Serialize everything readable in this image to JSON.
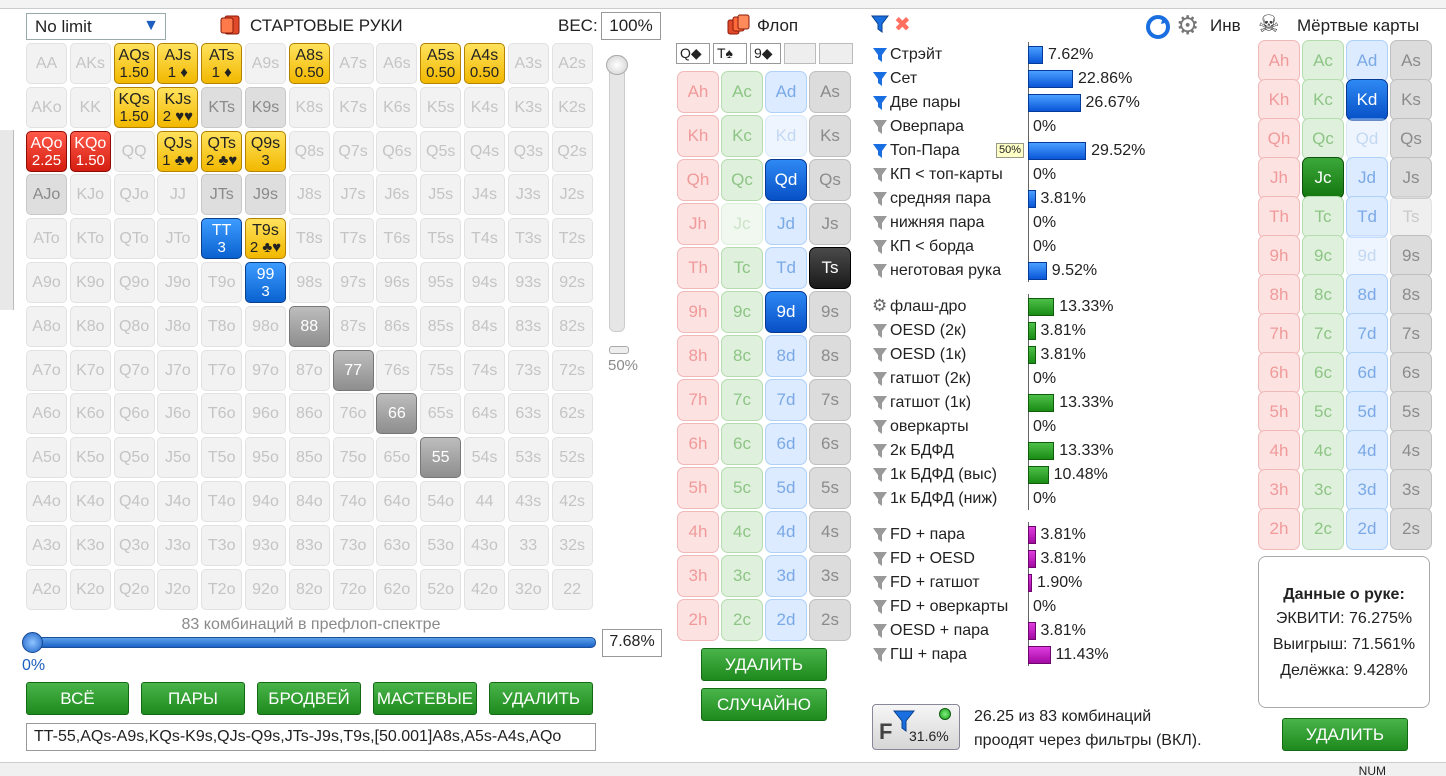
{
  "toolbar": {
    "game_select": "No limit",
    "start_hands_label": "СТАРТОВЫЕ РУКИ",
    "weight_label": "ВЕС:",
    "weight_value": "100%",
    "flop_label": "Флоп",
    "inv_label": "Инв",
    "dead_cards_label": "Мёртвые карты"
  },
  "preflop": {
    "ranks": [
      "A",
      "K",
      "Q",
      "J",
      "T",
      "9",
      "8",
      "7",
      "6",
      "5",
      "4",
      "3",
      "2"
    ],
    "special": {
      "AQs": {
        "style": "y",
        "w": "1.50"
      },
      "AJs": {
        "style": "y",
        "w": "1",
        "suit": "♦"
      },
      "ATs": {
        "style": "y",
        "w": "1",
        "suit": "♦"
      },
      "A8s": {
        "style": "y",
        "w": "0.50"
      },
      "A5s": {
        "style": "y",
        "w": "0.50"
      },
      "A4s": {
        "style": "y",
        "w": "0.50"
      },
      "KQs": {
        "style": "y",
        "w": "1.50"
      },
      "KJs": {
        "style": "y",
        "w": "2",
        "suit": "♥♥"
      },
      "QJs": {
        "style": "y",
        "w": "1",
        "suit": "♣♥"
      },
      "QTs": {
        "style": "y",
        "w": "2",
        "suit": "♣♥"
      },
      "Q9s": {
        "style": "y",
        "w": "3"
      },
      "AQo": {
        "style": "r",
        "w": "2.25"
      },
      "KQo": {
        "style": "r",
        "w": "1.50"
      },
      "TT": {
        "style": "b",
        "w": "3"
      },
      "T9s": {
        "style": "y",
        "w": "2",
        "suit": "♣♥"
      },
      "99": {
        "style": "b",
        "w": "3"
      },
      "88": {
        "style": "g"
      },
      "77": {
        "style": "g"
      },
      "66": {
        "style": "g"
      },
      "55": {
        "style": "g"
      },
      "AJo": {
        "style": "lg"
      },
      "JTs": {
        "style": "lg"
      },
      "J9s": {
        "style": "lg"
      },
      "KTs": {
        "style": "lg"
      },
      "K9s": {
        "style": "lg"
      }
    },
    "combos_text": "83 комбинаций в префлоп-спектре",
    "vslider_label": "50%",
    "hslider_left": "0%",
    "hslider_value": "7.68%",
    "slider_value_fraction": 0.0768,
    "buttons": [
      "ВСЁ",
      "ПАРЫ",
      "БРОДВЕЙ",
      "МАСТЕВЫЕ",
      "УДАЛИТЬ"
    ],
    "range_text": "TT-55,AQs-A9s,KQs-K9s,QJs-Q9s,JTs-J9s,T9s,[50.001]A8s,A5s-A4s,AQo"
  },
  "flop": {
    "slots": [
      "Q◆",
      "T♠",
      "9◆",
      "",
      ""
    ],
    "ranks": [
      "A",
      "K",
      "Q",
      "J",
      "T",
      "9",
      "8",
      "7",
      "6",
      "5",
      "4",
      "3",
      "2"
    ],
    "suits": [
      "h",
      "c",
      "d",
      "s"
    ],
    "selected": {
      "Qd": "sel-d",
      "Ts": "sel-s",
      "9d": "sel-d"
    },
    "dimmed": [
      "Kd",
      "Jc"
    ],
    "delete_button": "УДАЛИТЬ",
    "random_button": "СЛУЧАЙНО"
  },
  "stats": {
    "made": [
      {
        "name": "Стрэйт",
        "pct": "7.62%",
        "v": 7.62,
        "active": true
      },
      {
        "name": "Сет",
        "pct": "22.86%",
        "v": 22.86,
        "active": true
      },
      {
        "name": "Две пары",
        "pct": "26.67%",
        "v": 26.67,
        "active": true
      },
      {
        "name": "Оверпара",
        "pct": "0%",
        "v": 0,
        "active": false
      },
      {
        "name": "Топ-Пара",
        "pct": "29.52%",
        "v": 29.52,
        "active": true
      },
      {
        "name": "КП < топ-карты",
        "pct": "0%",
        "v": 0,
        "active": false
      },
      {
        "name": "средняя пара",
        "pct": "3.81%",
        "v": 3.81,
        "active": false
      },
      {
        "name": "нижняя пара",
        "pct": "0%",
        "v": 0,
        "active": false
      },
      {
        "name": "КП < борда",
        "pct": "0%",
        "v": 0,
        "active": false
      },
      {
        "name": "неготовая рука",
        "pct": "9.52%",
        "v": 9.52,
        "active": false
      }
    ],
    "draws": [
      {
        "name": "флаш-дро",
        "pct": "13.33%",
        "v": 13.33,
        "gear": true
      },
      {
        "name": "OESD (2к)",
        "pct": "3.81%",
        "v": 3.81
      },
      {
        "name": "OESD (1к)",
        "pct": "3.81%",
        "v": 3.81
      },
      {
        "name": "гатшот (2к)",
        "pct": "0%",
        "v": 0
      },
      {
        "name": "гатшот (1к)",
        "pct": "13.33%",
        "v": 13.33
      },
      {
        "name": "оверкарты",
        "pct": "0%",
        "v": 0
      },
      {
        "name": "2к БДФД",
        "pct": "13.33%",
        "v": 13.33
      },
      {
        "name": "1к БДФД (выс)",
        "pct": "10.48%",
        "v": 10.48
      },
      {
        "name": "1к БДФД (ниж)",
        "pct": "0%",
        "v": 0
      }
    ],
    "combos": [
      {
        "name": "FD + пара",
        "pct": "3.81%",
        "v": 3.81
      },
      {
        "name": "FD + OESD",
        "pct": "3.81%",
        "v": 3.81
      },
      {
        "name": "FD + гатшот",
        "pct": "1.90%",
        "v": 1.9
      },
      {
        "name": "FD + оверкарты",
        "pct": "0%",
        "v": 0
      },
      {
        "name": "OESD + пара",
        "pct": "3.81%",
        "v": 3.81
      },
      {
        "name": "ГШ + пара",
        "pct": "11.43%",
        "v": 11.43
      }
    ],
    "badge": "50%",
    "filter_pct": "31.6%",
    "filter_letter": "F",
    "summary_line1": "26.25 из 83 комбинаций",
    "summary_line2": "проодят через фильтры (ВКЛ)."
  },
  "dead": {
    "ranks": [
      "A",
      "K",
      "Q",
      "J",
      "T",
      "9",
      "8",
      "7",
      "6",
      "5",
      "4",
      "3",
      "2"
    ],
    "suits": [
      "h",
      "c",
      "d",
      "s"
    ],
    "selected": {
      "Kd": "sel-d",
      "Jc": "sel-c"
    },
    "dimmed": [
      "Qd",
      "Ts",
      "9d"
    ],
    "info_title": "Данные о руке:",
    "equity": "ЭКВИТИ: 76.275%",
    "win": "Выигрыш: 71.561%",
    "tie": "Делёжка: 9.428%",
    "delete_button": "УДАЛИТЬ"
  },
  "statusbar": {
    "num": "NUM"
  },
  "colors": {
    "green_button": "#1e8a1e",
    "blue_bar": "#0a56d8",
    "green_bar": "#198c15",
    "magenta_bar": "#a20aa2"
  }
}
